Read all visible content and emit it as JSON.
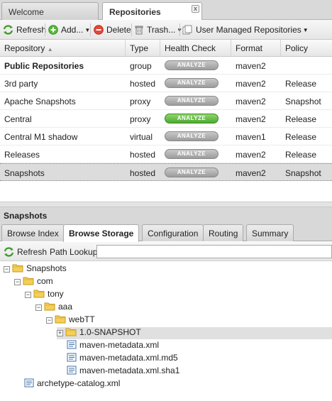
{
  "tabs": [
    {
      "label": "Welcome"
    },
    {
      "label": "Repositories",
      "close": "x"
    }
  ],
  "toolbar": {
    "refresh": "Refresh",
    "add": "Add...",
    "delete": "Delete",
    "trash": "Trash...",
    "user_managed": "User Managed Repositories"
  },
  "grid": {
    "headers": [
      "Repository",
      "Type",
      "Health Check",
      "Format",
      "Policy"
    ],
    "sort_indicator": "▲",
    "analyze_label": "ANALYZE",
    "rows": [
      {
        "name": "Public Repositories",
        "type": "group",
        "format": "maven2",
        "policy": "",
        "health": "gray"
      },
      {
        "name": "3rd party",
        "type": "hosted",
        "format": "maven2",
        "policy": "Release",
        "health": "gray"
      },
      {
        "name": "Apache Snapshots",
        "type": "proxy",
        "format": "maven2",
        "policy": "Snapshot",
        "health": "gray"
      },
      {
        "name": "Central",
        "type": "proxy",
        "format": "maven2",
        "policy": "Release",
        "health": "green"
      },
      {
        "name": "Central M1 shadow",
        "type": "virtual",
        "format": "maven1",
        "policy": "Release",
        "health": "gray"
      },
      {
        "name": "Releases",
        "type": "hosted",
        "format": "maven2",
        "policy": "Release",
        "health": "gray"
      },
      {
        "name": "Snapshots",
        "type": "hosted",
        "format": "maven2",
        "policy": "Snapshot",
        "health": "gray"
      }
    ]
  },
  "detail": {
    "title": "Snapshots",
    "tabs": [
      "Browse Index",
      "Browse Storage",
      "Configuration",
      "Routing",
      "Summary"
    ],
    "active_tab": "Browse Storage",
    "refresh": "Refresh",
    "path_lookup_label": "Path Lookup:",
    "path_lookup_value": "",
    "tree": [
      {
        "label": "Snapshots",
        "kind": "folder",
        "toggle": "−"
      },
      {
        "label": "com",
        "kind": "folder",
        "toggle": "−"
      },
      {
        "label": "tony",
        "kind": "folder",
        "toggle": "−"
      },
      {
        "label": "aaa",
        "kind": "folder",
        "toggle": "−"
      },
      {
        "label": "webTT",
        "kind": "folder",
        "toggle": "−"
      },
      {
        "label": "1.0-SNAPSHOT",
        "kind": "folder",
        "toggle": "+"
      },
      {
        "label": "maven-metadata.xml",
        "kind": "file"
      },
      {
        "label": "maven-metadata.xml.md5",
        "kind": "file"
      },
      {
        "label": "maven-metadata.xml.sha1",
        "kind": "file"
      },
      {
        "label": "archetype-catalog.xml",
        "kind": "file"
      }
    ]
  },
  "colors": {
    "analyze_gray": "#a8a8a8",
    "analyze_green": "#5cb83a",
    "folder": "#f2c94c"
  }
}
